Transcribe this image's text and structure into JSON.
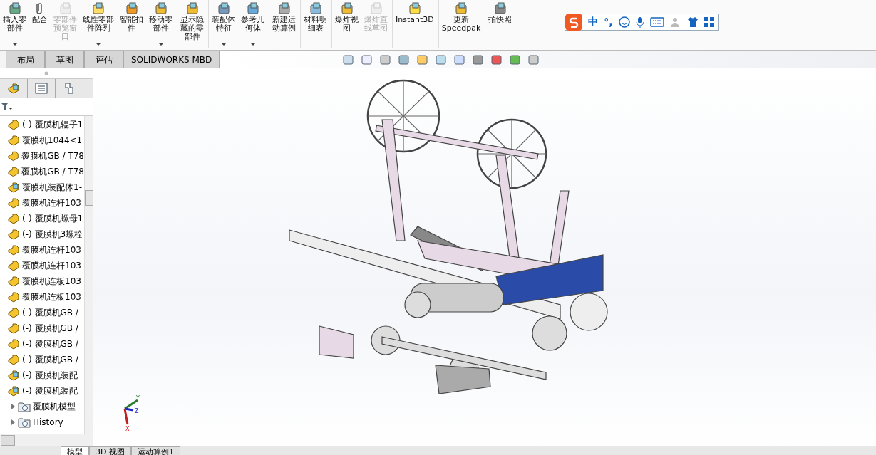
{
  "toolbar": {
    "buttons": [
      {
        "lines": [
          "插入零",
          "部件"
        ],
        "disabled": false,
        "dropdown": true,
        "kind": "insert"
      },
      {
        "lines": [
          "配合"
        ],
        "disabled": false,
        "dropdown": false,
        "kind": "mate"
      },
      {
        "lines": [
          "零部件",
          "预览窗",
          "口"
        ],
        "disabled": true,
        "dropdown": false,
        "kind": "preview"
      },
      {
        "lines": [
          "线性零部",
          "件阵列"
        ],
        "disabled": false,
        "dropdown": true,
        "kind": "pattern"
      },
      {
        "lines": [
          "智能扣",
          "件"
        ],
        "disabled": false,
        "dropdown": false,
        "kind": "fastener"
      },
      {
        "lines": [
          "移动零",
          "部件"
        ],
        "disabled": false,
        "dropdown": true,
        "kind": "move"
      },
      {
        "lines": [
          "显示隐",
          "藏的零",
          "部件"
        ],
        "disabled": false,
        "dropdown": false,
        "kind": "show",
        "sep": true
      },
      {
        "lines": [
          "装配体",
          "特征"
        ],
        "disabled": false,
        "dropdown": true,
        "kind": "feature",
        "sep": true
      },
      {
        "lines": [
          "参考几",
          "何体"
        ],
        "disabled": false,
        "dropdown": true,
        "kind": "reference"
      },
      {
        "lines": [
          "新建运",
          "动算例"
        ],
        "disabled": false,
        "dropdown": false,
        "kind": "motion",
        "sep": true
      },
      {
        "lines": [
          "材料明",
          "细表"
        ],
        "disabled": false,
        "dropdown": false,
        "kind": "bom",
        "sep": true
      },
      {
        "lines": [
          "爆炸视",
          "图"
        ],
        "disabled": false,
        "dropdown": false,
        "kind": "explode",
        "sep": true
      },
      {
        "lines": [
          "爆炸直",
          "线草图"
        ],
        "disabled": true,
        "dropdown": false,
        "kind": "explode"
      },
      {
        "lines": [
          "Instant3D"
        ],
        "disabled": false,
        "dropdown": false,
        "kind": "instant",
        "sep": true
      },
      {
        "lines": [
          "更新",
          "Speedpak"
        ],
        "disabled": false,
        "dropdown": false,
        "kind": "speedpak",
        "sep": true
      },
      {
        "lines": [
          "拍快照"
        ],
        "disabled": false,
        "dropdown": false,
        "kind": "snapshot",
        "sep": true
      }
    ]
  },
  "triad": {
    "x": "X",
    "y": "Y",
    "z": "Z"
  },
  "ime_bar": {
    "mode": "中",
    "punct": "°,"
  },
  "tabs": [
    {
      "label": "布局",
      "selected": false
    },
    {
      "label": "草图",
      "selected": false
    },
    {
      "label": "评估",
      "selected": false
    },
    {
      "label": "SOLIDWORKS MBD",
      "selected": false
    }
  ],
  "tree": {
    "items": [
      {
        "label": "(-) 覆膜机辊子1",
        "kind": "part"
      },
      {
        "label": "覆膜机1044<1",
        "kind": "part"
      },
      {
        "label": "覆膜机GB / T78",
        "kind": "part"
      },
      {
        "label": "覆膜机GB / T78",
        "kind": "part"
      },
      {
        "label": "覆膜机装配体1-",
        "kind": "assembly"
      },
      {
        "label": "覆膜机连杆103",
        "kind": "part"
      },
      {
        "label": "(-) 覆膜机螺母1",
        "kind": "part"
      },
      {
        "label": "(-) 覆膜机3螺栓",
        "kind": "part"
      },
      {
        "label": "覆膜机连杆103",
        "kind": "part"
      },
      {
        "label": "覆膜机连杆103",
        "kind": "part"
      },
      {
        "label": "覆膜机连板103",
        "kind": "part"
      },
      {
        "label": "覆膜机连板103",
        "kind": "part"
      },
      {
        "label": "(-) 覆膜机GB /",
        "kind": "part"
      },
      {
        "label": "(-) 覆膜机GB /",
        "kind": "part"
      },
      {
        "label": "(-) 覆膜机GB /",
        "kind": "part"
      },
      {
        "label": "(-) 覆膜机GB /",
        "kind": "part"
      },
      {
        "label": "(-) 覆膜机装配",
        "kind": "assembly"
      },
      {
        "label": "(-) 覆膜机装配",
        "kind": "assembly"
      },
      {
        "label": "覆膜机模型",
        "kind": "folder",
        "expanded": false
      },
      {
        "label": "History",
        "kind": "history",
        "expanded": false
      }
    ]
  },
  "bottom_tabs": [
    {
      "label": "模型",
      "selected": true
    },
    {
      "label": "3D 视图",
      "selected": false
    },
    {
      "label": "运动算例1",
      "selected": false
    }
  ]
}
